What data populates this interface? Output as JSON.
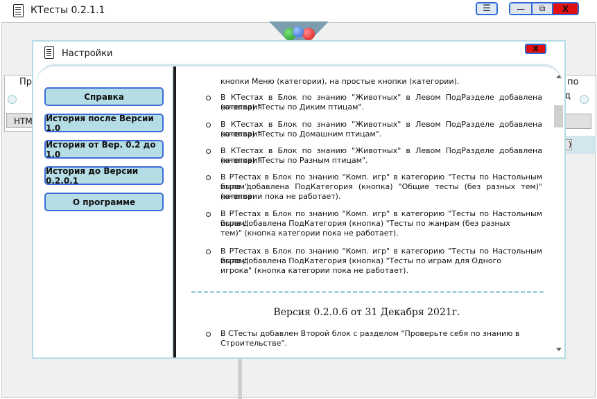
{
  "app": {
    "title": "КТесты 0.2.1.1",
    "menu_icon": "☰",
    "min_icon": "—",
    "max_icon": "⧉",
    "close_icon": "X"
  },
  "background": {
    "left_text": "Пр",
    "left_text2": "з",
    "left_button": "HTM",
    "right_text1": "по",
    "right_text2": "д",
    "right_paren": ")"
  },
  "dialog": {
    "title": "Настройки",
    "close_label": "X",
    "nav": [
      {
        "label": "Справка"
      },
      {
        "label": "История после Версии 1.0"
      },
      {
        "label": "История от Вер. 0.2 до 1.0"
      },
      {
        "label": "История до Версии 0.2.0.1"
      },
      {
        "label": "О программе"
      }
    ],
    "content": {
      "fragment_top": "кнопки Меню (категории), на простые кнопки (категории).",
      "items": [
        {
          "line1": "В КТестах в Блок по знанию \"Животных\" в Левом ПодРазделе добавлена категория",
          "line2": "(кнопка) \"Тесты по Диким птицам\"."
        },
        {
          "line1": "В КТестах в Блок по знанию \"Животных\" в Левом ПодРазделе добавлена категория",
          "line2": "(кнопка) \"Тесты по Домашним птицам\"."
        },
        {
          "line1": "В КТестах в Блок по знанию \"Животных\" в Левом ПодРазделе добавлена категория",
          "line2": "(кнопка) \"Тесты по Разным птицам\"."
        },
        {
          "line1": "В РТестах в Блок по знанию \"Комп. игр\" в категорию \"Тесты по Настольным играм\"",
          "line2": "была добавлена ПодКатегория (кнопка) \"Общие тесты (без разных тем)\" (кнопка",
          "line3": "категории пока не работает)."
        },
        {
          "line1": "В РТестах в Блок по знанию \"Комп. игр\" в категорию \"Тесты по Настольным играм\"",
          "line2": "была добавлена ПодКатегория (кнопка) \"Тесты по жанрам (без разных",
          "line3": "тем)\" (кнопка категории пока не работает)."
        },
        {
          "line1": "В РТестах в Блок по знанию \"Комп. игр\" в категорию \"Тесты по Настольным играм\"",
          "line2": "была добавлена ПодКатегория (кнопка) \"Тесты по играм для Одного",
          "line3": "игрока\" (кнопка категории пока не работает)."
        }
      ],
      "version_heading": "Версия 0.2.0.6 от 31 Декабря 2021г.",
      "last_item": {
        "line1": "В СТесты добавлен Второй блок с разделом \"Проверьте себя по знанию в",
        "line2": "Строительстве\"."
      }
    }
  }
}
